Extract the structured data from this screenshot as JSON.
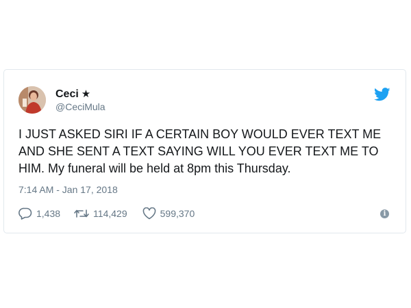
{
  "tweet": {
    "author": {
      "display_name": "Ceci",
      "badge_glyph": "★",
      "handle": "@CeciMula",
      "avatar_icon": "profile-photo"
    },
    "brand_icon": "twitter-bird-icon",
    "text": "I JUST ASKED SIRI IF A CERTAIN BOY WOULD EVER TEXT ME AND SHE SENT A TEXT SAYING WILL YOU EVER TEXT ME TO HIM. My funeral will be held at 8pm this Thursday.",
    "timestamp": "7:14 AM - Jan 17, 2018",
    "stats": {
      "replies": "1,438",
      "retweets": "114,429",
      "likes": "599,370"
    },
    "colors": {
      "brand_blue": "#1da1f2",
      "muted_gray": "#657786",
      "text": "#14171a"
    }
  }
}
